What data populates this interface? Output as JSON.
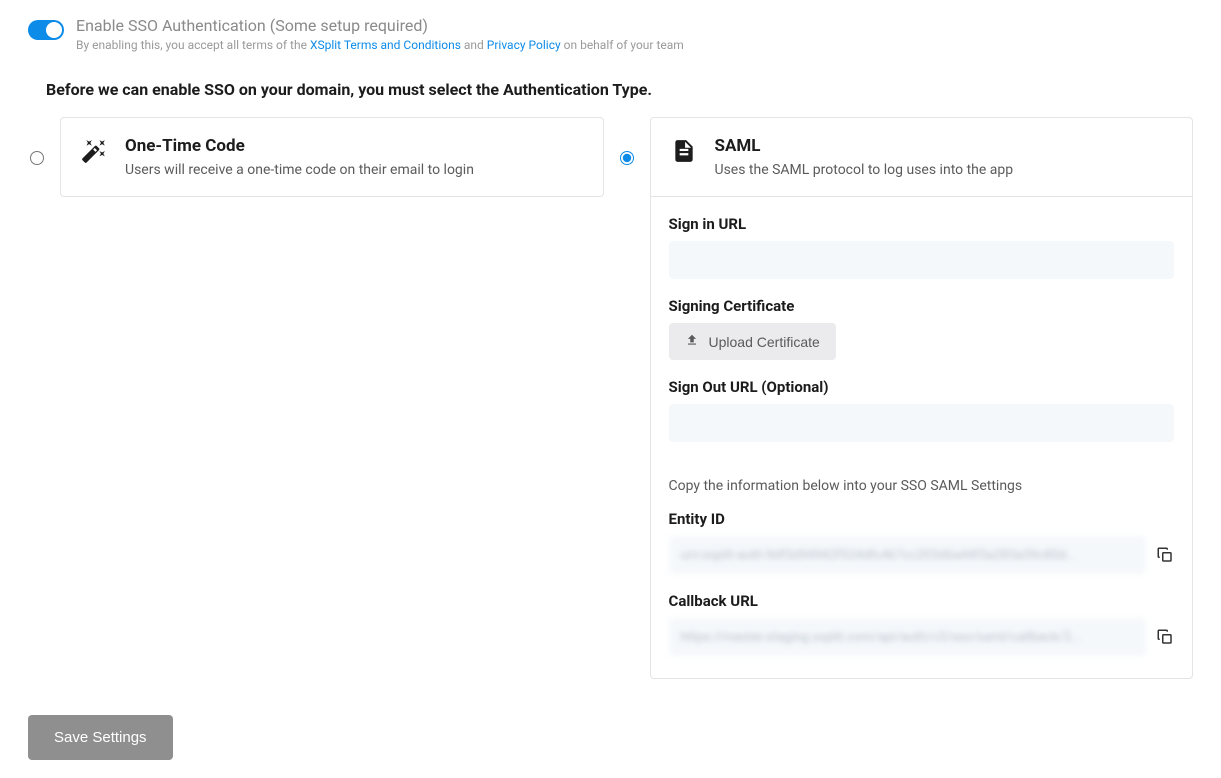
{
  "header": {
    "title": "Enable SSO Authentication (Some setup required)",
    "subtitle_before": "By enabling this, you accept all terms of the ",
    "link_terms": "XSplit Terms and Conditions",
    "subtitle_mid": " and ",
    "link_privacy": "Privacy Policy",
    "subtitle_after": " on behalf of your team"
  },
  "instruction": "Before we can enable SSO on your domain, you must select the Authentication Type.",
  "option_otp": {
    "title": "One-Time Code",
    "desc": "Users will receive a one-time code on their email to login"
  },
  "option_saml": {
    "title": "SAML",
    "desc": "Uses the SAML protocol to log uses into the app"
  },
  "saml_form": {
    "signin_label": "Sign in URL",
    "signin_value": "",
    "cert_label": "Signing Certificate",
    "upload_label": "Upload Certificate",
    "signout_label": "Sign Out URL (Optional)",
    "signout_value": "",
    "copy_hint": "Copy the information below into your SSO SAML Settings",
    "entity_label": "Entity ID",
    "entity_value": "urn:xsplit-auth:9df3d94942f524dfc467cc203d6a44f3a283a39c80d...",
    "callback_label": "Callback URL",
    "callback_value": "https://master.staging.xsplit.com/api/auth/v3/sso/saml/callback/2..."
  },
  "save_label": "Save Settings"
}
